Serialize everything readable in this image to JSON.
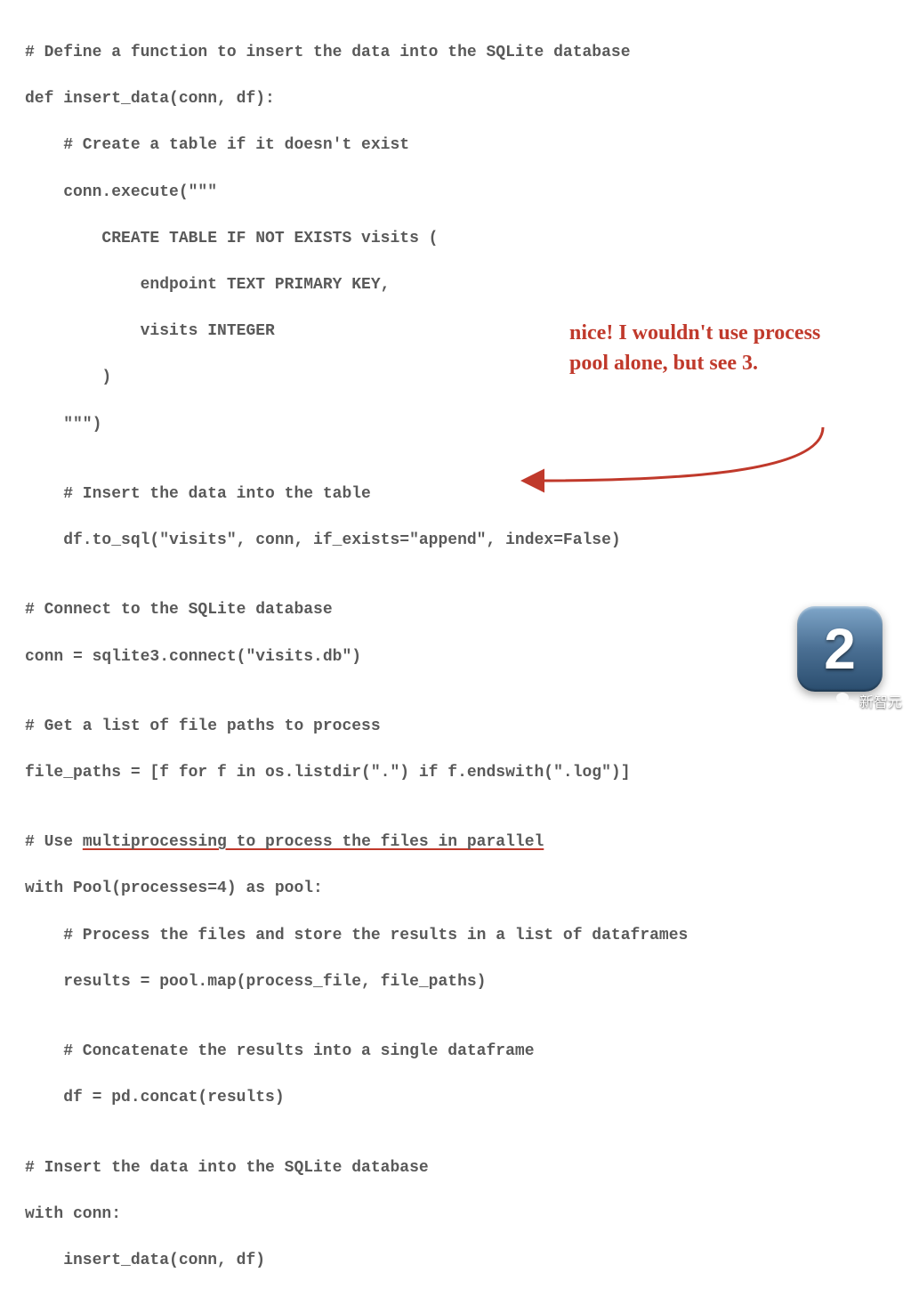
{
  "code": {
    "l1": "# Define a function to insert the data into the SQLite database",
    "l2": "def insert_data(conn, df):",
    "l3": "    # Create a table if it doesn't exist",
    "l4": "    conn.execute(\"\"\"",
    "l5": "        CREATE TABLE IF NOT EXISTS visits (",
    "l6": "            endpoint TEXT PRIMARY KEY,",
    "l7": "            visits INTEGER",
    "l8": "        )",
    "l9": "    \"\"\")",
    "l10": "",
    "l11": "    # Insert the data into the table",
    "l12": "    df.to_sql(\"visits\", conn, if_exists=\"append\", index=False)",
    "l13": "",
    "l14": "# Connect to the SQLite database",
    "l15": "conn = sqlite3.connect(\"visits.db\")",
    "l16": "",
    "l17": "# Get a list of file paths to process",
    "l18": "file_paths = [f for f in os.listdir(\".\") if f.endswith(\".log\")]",
    "l19": "",
    "l20_prefix": "# Use ",
    "l20_underlined": "multiprocessing to process the files in parallel",
    "l21": "with Pool(processes=4) as pool:",
    "l22": "    # Process the files and store the results in a list of dataframes",
    "l23": "    results = pool.map(process_file, file_paths)",
    "l24": "",
    "l25": "    # Concatenate the results into a single dataframe",
    "l26": "    df = pd.concat(results)",
    "l27": "",
    "l28": "# Insert the data into the SQLite database",
    "l29": "with conn:",
    "l30": "    insert_data(conn, df)"
  },
  "annotation": {
    "text": "nice! I wouldn't use process pool alone, but see 3.",
    "color": "#c0392b"
  },
  "badge": {
    "number": "2"
  },
  "watermark": {
    "text": "新智元"
  }
}
